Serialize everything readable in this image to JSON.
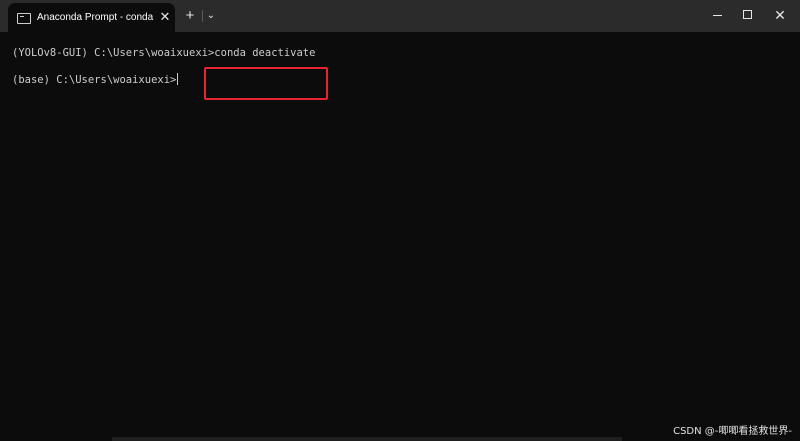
{
  "window": {
    "tab_title": "Anaconda Prompt - conda  de",
    "tab_close": "✕",
    "new_tab": "+",
    "dropdown": "⌄",
    "close": "✕"
  },
  "console": {
    "line1_prompt": "(YOLOv8-GUI) C:\\Users\\woaixuexi>",
    "line1_command": "conda deactivate",
    "line2_prompt": "(base) C:\\Users\\woaixuexi>"
  },
  "watermark": "CSDN @-唧唧看拯救世界-",
  "colors": {
    "highlight": "#e5262f",
    "background": "#0c0c0c",
    "titlebar": "#2b2b2b",
    "text": "#cccccc"
  }
}
